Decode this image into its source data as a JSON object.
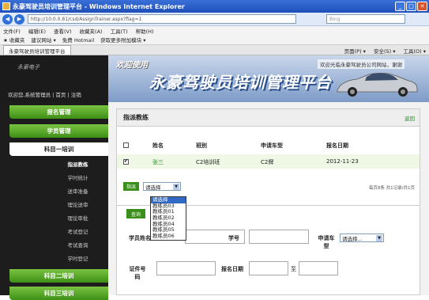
{
  "browser": {
    "title": "永豪驾驶员培训管理平台 - Windows Internet Explorer",
    "url": "http://10.0.0.81/csd/AssignTrainer.aspx?flag=1",
    "search_placeholder": "Bing",
    "menu": [
      "文件(F)",
      "编辑(E)",
      "查看(V)",
      "收藏夹(A)",
      "工具(T)",
      "帮助(H)"
    ],
    "favorites": [
      "收藏夹",
      "建议网站 ▾",
      "免费 Hotmail",
      "获取更多附加模块 ▾"
    ],
    "tab_label": "永豪驾驶员培训管理平台",
    "tab_tools": [
      "页面(P) ▾",
      "安全(S) ▾",
      "工具(O) ▾"
    ]
  },
  "banner": {
    "logo": "永豪电子",
    "greeting": "欢迎您,系统管理员 | 首页 | 注销",
    "slogan": "欢迎使用",
    "title": "永豪驾驶员培训管理平台",
    "marquee": "欢迎光临永豪驾驶员公司网站，谢谢"
  },
  "sidebar": {
    "groups": [
      {
        "label": "报名管理"
      },
      {
        "label": "学员管理"
      },
      {
        "label": "科目一培训"
      }
    ],
    "sub_items": [
      "指派教练",
      "学时统计",
      "送审准备",
      "理论送审",
      "理论审批",
      "考试登记",
      "考试查询",
      "学时登记"
    ],
    "more_groups": [
      {
        "label": "科目二培训"
      },
      {
        "label": "科目三培训"
      }
    ]
  },
  "panel": {
    "title": "指派教练",
    "back": "返回",
    "columns": [
      "姓名",
      "班别",
      "申请车型",
      "报名日期"
    ],
    "rows": [
      {
        "name": "张三",
        "class": "C2培训班",
        "car": "C2牌",
        "date": "2012-11-23"
      }
    ],
    "assign_button": "指派",
    "select_value": "请选择",
    "dropdown_options": [
      "请选择",
      "教练员03",
      "教练员01",
      "教练员02",
      "教练员04",
      "教练员05",
      "教练员06"
    ],
    "pager": "每页8条  共1记录/共1页",
    "query_button": "查询",
    "filters": {
      "student_label": "学员姓名",
      "student_id_label": "学号",
      "car_label": "申请车型",
      "car_select": "请选择...",
      "cert_label": "证件号码",
      "date_label": "报名日期",
      "date_sep": "至"
    }
  },
  "colors": {
    "green": "#3d8f16",
    "banner_blue": "#2a4f8a",
    "ie_blue": "#1f4fb8"
  }
}
